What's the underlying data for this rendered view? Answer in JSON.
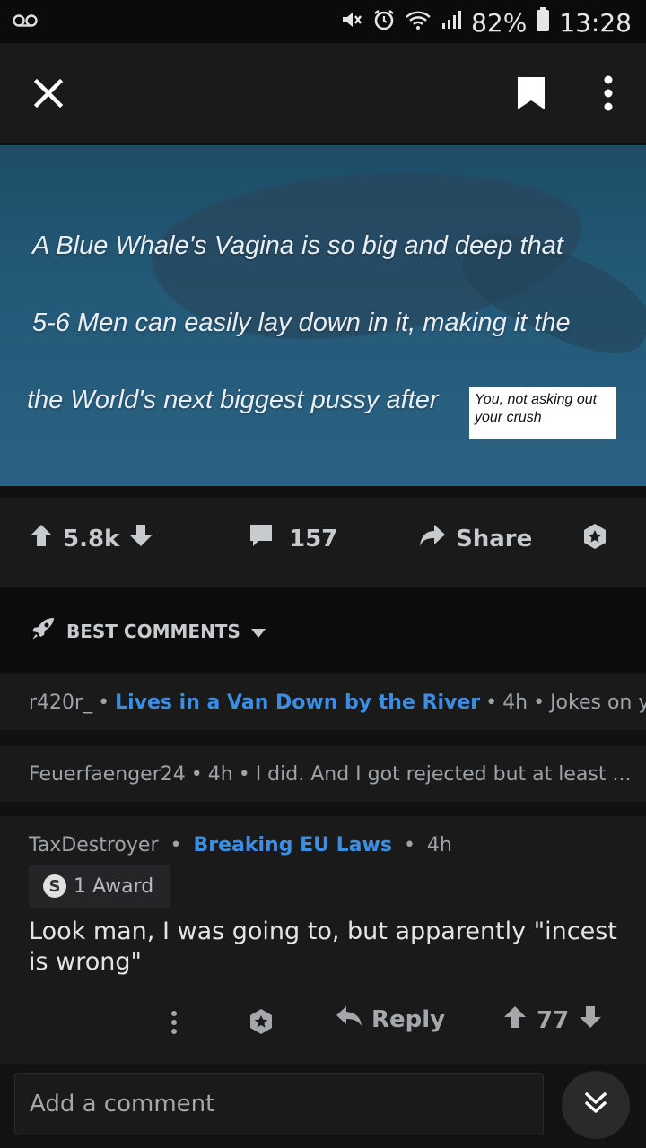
{
  "status_bar": {
    "voicemail_icon": "voicemail-icon",
    "battery_percent": "82%",
    "time": "13:28"
  },
  "toolbar": {
    "close_icon": "close-icon",
    "save_icon": "bookmark-icon",
    "more_icon": "more-vertical-icon"
  },
  "post": {
    "image_text": {
      "line1": "A Blue Whale's Vagina is so big and deep that",
      "line2": "5-6 Men can easily lay down in it, making it the",
      "line3": "the World's next biggest pussy after",
      "caption_box": "You, not asking out your crush"
    },
    "votes": "5.8k",
    "comment_count": "157",
    "share_label": "Share"
  },
  "sort": {
    "label": "BEST COMMENTS"
  },
  "comments": [
    {
      "author": "r420r_",
      "flair": "Lives in a Van Down by the River",
      "time": "4h",
      "preview": "Jokes on y..."
    },
    {
      "author": "Feuerfaenger24",
      "time": "4h",
      "preview": "I did. And I got rejected but at least ..."
    },
    {
      "author": "TaxDestroyer",
      "flair": "Breaking EU Laws",
      "time": "4h",
      "award_text": "1 Award",
      "body": "Look man, I was going to, but apparently \"incest is wrong\"",
      "reply_label": "Reply",
      "score": "77"
    }
  ],
  "composer": {
    "placeholder": "Add a comment"
  },
  "colors": {
    "flair_blue": "#3c8ee2",
    "background": "#111111",
    "card": "#1a1a1b"
  }
}
